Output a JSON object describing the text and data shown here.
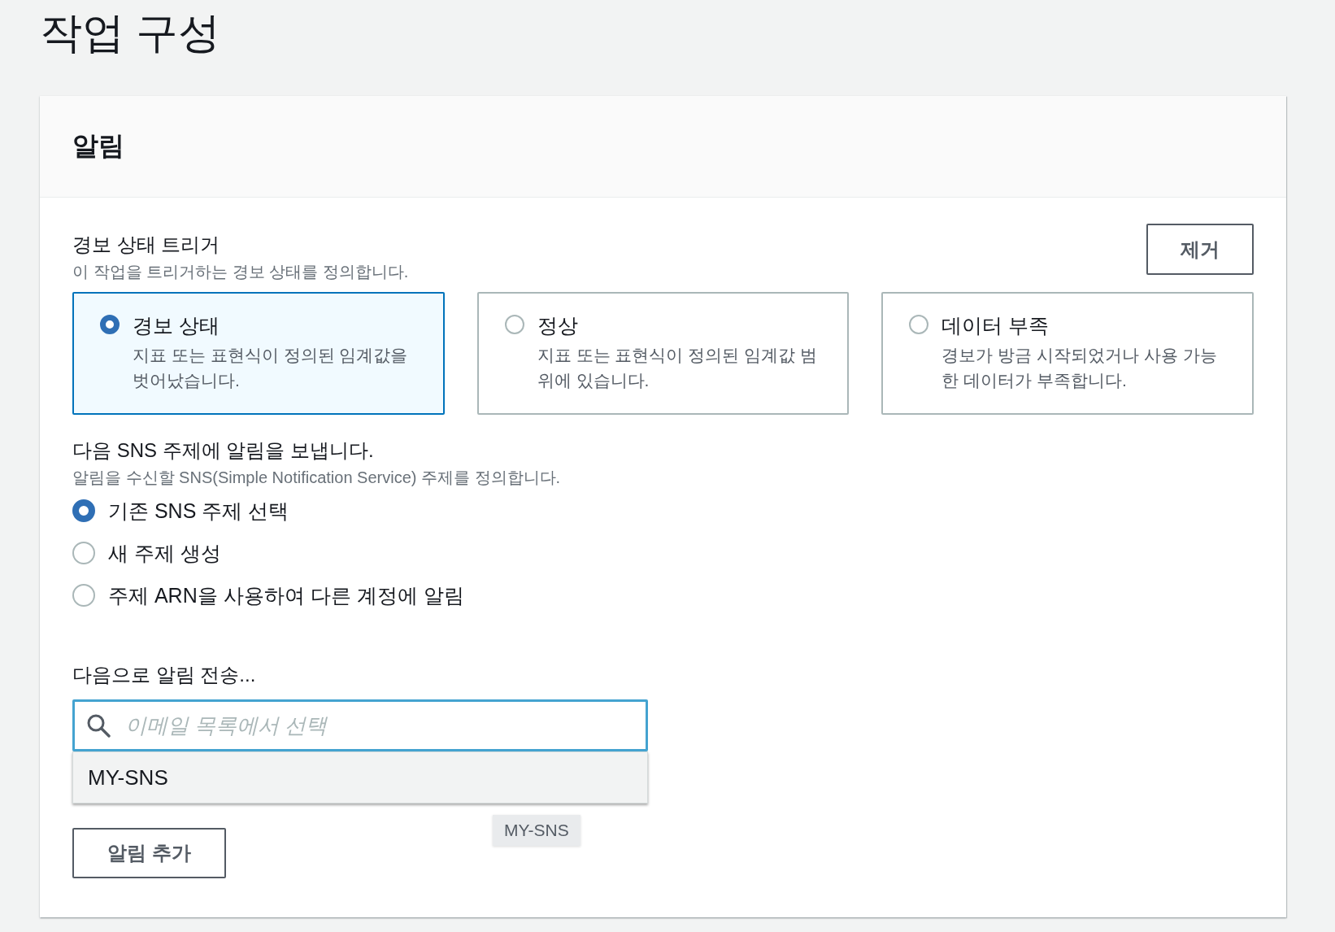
{
  "page_title": "작업 구성",
  "panel": {
    "title": "알림"
  },
  "alarm_trigger": {
    "label": "경보 상태 트리거",
    "description": "이 작업을 트리거하는 경보 상태를 정의합니다.",
    "remove_button": "제거",
    "options": [
      {
        "title": "경보 상태",
        "description": "지표 또는 표현식이 정의된 임계값을 벗어났습니다.",
        "selected": true
      },
      {
        "title": "정상",
        "description": "지표 또는 표현식이 정의된 임계값 범위에 있습니다.",
        "selected": false
      },
      {
        "title": "데이터 부족",
        "description": "경보가 방금 시작되었거나 사용 가능한 데이터가 부족합니다.",
        "selected": false
      }
    ]
  },
  "sns": {
    "label": "다음 SNS 주제에 알림을 보냅니다.",
    "description": "알림을 수신할 SNS(Simple Notification Service) 주제를 정의합니다.",
    "options": [
      {
        "label": "기존 SNS 주제 선택",
        "selected": true
      },
      {
        "label": "새 주제 생성",
        "selected": false
      },
      {
        "label": "주제 ARN을 사용하여 다른 계정에 알림",
        "selected": false
      }
    ]
  },
  "send_to": {
    "label": "다음으로 알림 전송...",
    "search": {
      "placeholder": "이메일 목록에서 선택"
    },
    "dropdown_items": [
      "MY-SNS"
    ]
  },
  "tooltip": "MY-SNS",
  "add_button": "알림 추가"
}
